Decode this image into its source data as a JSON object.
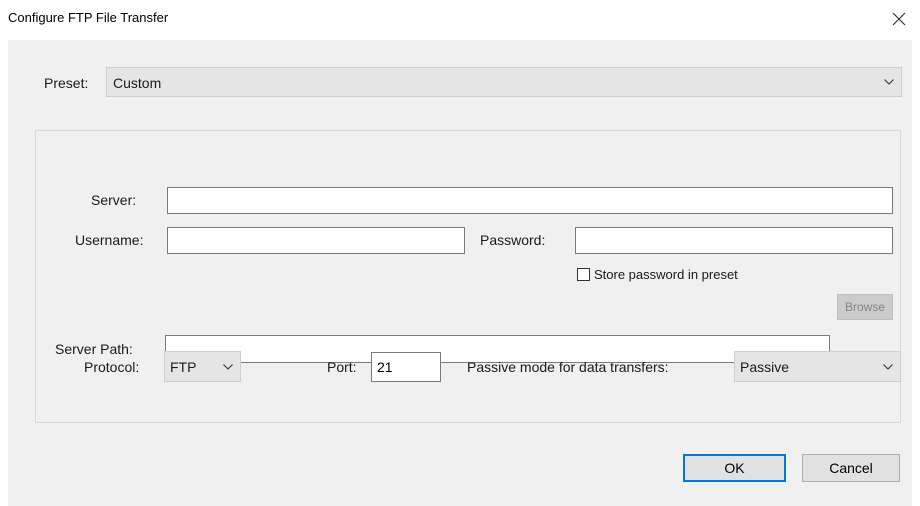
{
  "window": {
    "title": "Configure FTP File Transfer"
  },
  "preset": {
    "label": "Preset:",
    "value": "Custom"
  },
  "form": {
    "server_label": "Server:",
    "server_value": "",
    "username_label": "Username:",
    "username_value": "",
    "password_label": "Password:",
    "password_value": "",
    "store_password_label": "Store password in preset",
    "store_password_checked": false,
    "server_path_label": "Server Path:",
    "server_path_value": "",
    "browse_label": "Browse",
    "protocol_label": "Protocol:",
    "protocol_value": "FTP",
    "port_label": "Port:",
    "port_value": "21",
    "passive_label": "Passive mode for data transfers:",
    "passive_value": "Passive"
  },
  "buttons": {
    "ok": "OK",
    "cancel": "Cancel"
  },
  "colors": {
    "dialog_background": "#f0f0f0",
    "default_button_border": "#0078d7",
    "dropdown_background": "#e5e5e5"
  },
  "icons": {
    "close": "close-icon",
    "dropdown": "chevron-down-icon"
  }
}
